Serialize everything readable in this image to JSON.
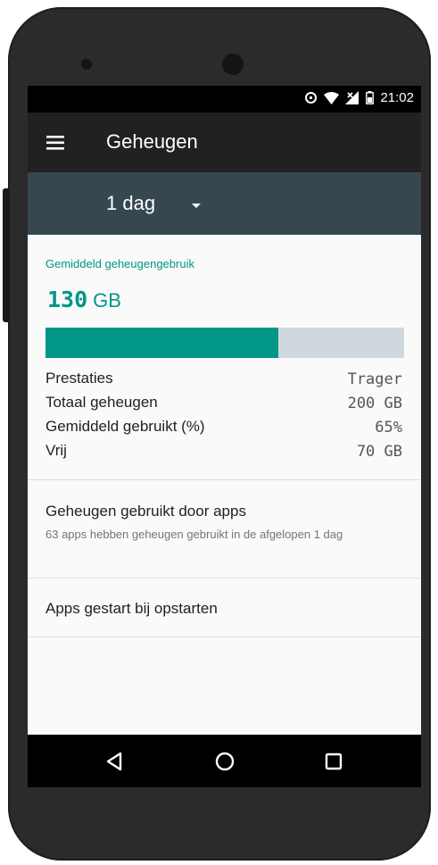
{
  "statusbar": {
    "time": "21:02",
    "icons": [
      "data-saver-icon",
      "wifi-icon",
      "signal-off-icon",
      "battery-icon"
    ]
  },
  "toolbar": {
    "menu_icon": "hamburger-menu-icon",
    "title": "Geheugen"
  },
  "period_selector": {
    "selected": "1 dag",
    "icon": "dropdown-arrow-icon"
  },
  "memory_summary": {
    "label": "Gemiddeld geheugengebruik",
    "value": "130",
    "unit": "GB",
    "usage_fraction": 0.65,
    "bar_colors": {
      "used": "#009688",
      "free": "#cfd8dc"
    }
  },
  "stats": [
    {
      "label": "Prestaties",
      "value": "Trager"
    },
    {
      "label": "Totaal geheugen",
      "value": "200 GB"
    },
    {
      "label": "Gemiddeld gebruikt (%)",
      "value": "65%"
    },
    {
      "label": "Vrij",
      "value": "70 GB"
    }
  ],
  "list": [
    {
      "title": "Geheugen gebruikt door apps",
      "subtitle": "63 apps hebben geheugen gebruikt in de afgelopen 1 dag"
    },
    {
      "title": "Apps gestart bij opstarten"
    }
  ],
  "navigation": {
    "buttons": [
      "back-icon",
      "home-icon",
      "recents-icon"
    ]
  },
  "colors": {
    "accent": "#009688",
    "toolbar": "#212121",
    "spinner_bar": "#37474f",
    "status_bar": "#000000",
    "nav_bar": "#000000"
  }
}
